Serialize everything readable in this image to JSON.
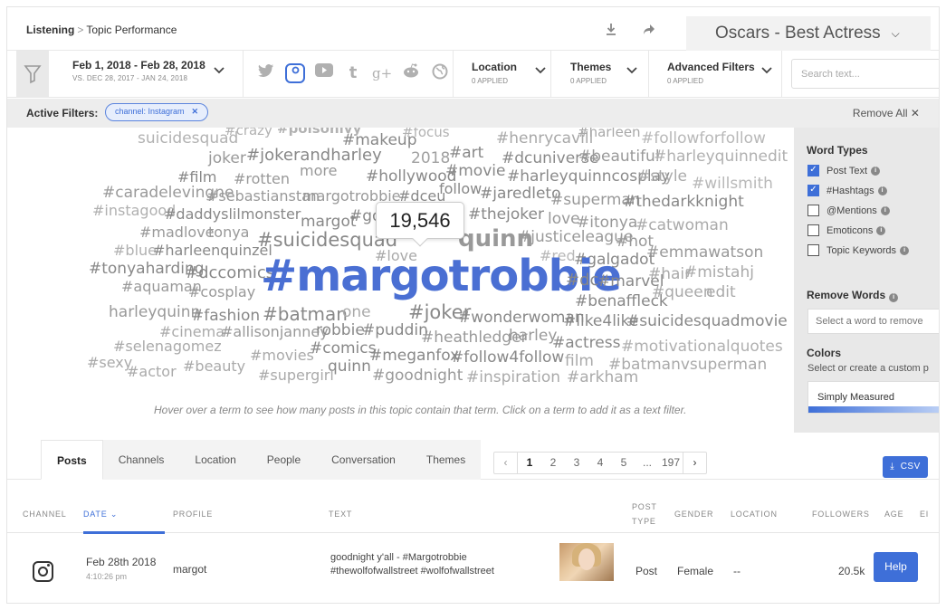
{
  "breadcrumb": {
    "root": "Listening",
    "separator": ">",
    "current": "Topic Performance"
  },
  "topic_selector": {
    "label": "Oscars - Best Actress"
  },
  "date_range": {
    "primary": "Feb 1, 2018 - Feb 28, 2018",
    "comparison": "VS. DEC 28, 2017 - JAN 24, 2018"
  },
  "networks": [
    "twitter-icon",
    "instagram-icon",
    "youtube-icon",
    "tumblr-icon",
    "google-plus-icon",
    "reddit-icon",
    "web-icon"
  ],
  "networks_glyphs": {
    "tumblr": "t",
    "google": "g+"
  },
  "filters": {
    "location": {
      "label": "Location",
      "sub": "0 APPLIED"
    },
    "themes": {
      "label": "Themes",
      "sub": "0 APPLIED"
    },
    "advanced": {
      "label": "Advanced Filters",
      "sub": "0 APPLIED"
    }
  },
  "search": {
    "placeholder": "Search text..."
  },
  "active_filters": {
    "label": "Active Filters:",
    "chip": "channel: Instagram",
    "chip_close": "✕",
    "remove_all": "Remove All ✕"
  },
  "word_cloud": {
    "tooltip": "19,546",
    "hint": "Hover over a term to see how many posts in this topic contain that term. Click on a term to add it as a text filter.",
    "words": [
      "suicidesquad",
      "#crazy",
      "#poisonivy",
      "#makeup",
      "#focus",
      "#henrycavill",
      "#harleen",
      "#followforfollow",
      "joker",
      "#jokerandharley",
      "2018",
      "#art",
      "#dcuniverse",
      "#beautiful",
      "#harleyquinnedit",
      "#film",
      "#rotten",
      "more",
      "#hollywood",
      "#movie",
      "#harleyquinncosplay",
      "#style",
      "#willsmith",
      "#caradelevingne",
      "#sebastianstan",
      "margotrobbie",
      "#dceu",
      "follow",
      "#jaredleto",
      "#superman",
      "#thedarkknight",
      "#instagood",
      "#daddyslilmonster",
      "margot",
      "#got",
      "#thejoker",
      "love",
      "#itonya",
      "#catwoman",
      "#madlove",
      "tonya",
      "#suicidesquad",
      "#love",
      "quinn",
      "#justiceleague",
      "#hot",
      "#blue",
      "#harleenquinzel",
      "#red",
      "#galgadot",
      "#emmawatson",
      "#tonyaharding",
      "#dccomics",
      "#margotrobbie",
      "#dc",
      "#marvel",
      "#hair",
      "#mistahj",
      "#aquaman",
      "#cosplay",
      "#benaffleck",
      "#queen",
      "edit",
      "harleyquinn",
      "#fashion",
      "#batman",
      "one",
      "#joker",
      "#wonderwoman",
      "#like4like",
      "#suicidesquadmovie",
      "#cinema",
      "#allisonjanney",
      "robbie",
      "#puddin",
      "#heathledger",
      "harley",
      "#actress",
      "#motivationalquotes",
      "#selenagomez",
      "#movies",
      "#comics",
      "#meganfox",
      "#follow4follow",
      "film",
      "#batmanvsuperman",
      "#sexy",
      "#actor",
      "#beauty",
      "quinn",
      "#supergirl",
      "#goodnight",
      "#inspiration",
      "#arkham"
    ]
  },
  "panel": {
    "word_types_title": "Word Types",
    "word_types": [
      {
        "label": "Post Text",
        "checked": true
      },
      {
        "label": "#Hashtags",
        "checked": true
      },
      {
        "label": "@Mentions",
        "checked": false
      },
      {
        "label": "Emoticons",
        "checked": false
      },
      {
        "label": "Topic Keywords",
        "checked": false
      }
    ],
    "remove_words_title": "Remove Words",
    "remove_words_placeholder": "Select a word to remove",
    "colors_title": "Colors",
    "colors_sub": "Select or create a custom p",
    "color_scheme": "Simply Measured"
  },
  "tabs": [
    "Posts",
    "Channels",
    "Location",
    "People",
    "Conversation",
    "Themes"
  ],
  "pager": {
    "pages": [
      "1",
      "2",
      "3",
      "4",
      "5",
      "...",
      "197"
    ],
    "current": "1"
  },
  "csv_button": "CSV",
  "table": {
    "headers": {
      "channel": "CHANNEL",
      "date": "DATE",
      "profile": "PROFILE",
      "text": "TEXT",
      "post_type_1": "POST",
      "post_type_2": "TYPE",
      "gender": "GENDER",
      "location": "LOCATION",
      "followers": "FOLLOWERS",
      "age": "AGE",
      "extra": "EI"
    },
    "row": {
      "date": "Feb 28th 2018",
      "time": "4:10:26 pm",
      "profile": "margot",
      "text_line1": "goodnight y'all - #Margotrobbie",
      "text_line2": "#thewolfofwallstreet #wolfofwallstreet",
      "post_type": "Post",
      "gender": "Female",
      "location": "--",
      "followers": "20.5k"
    }
  },
  "help_button": "Help",
  "colors": {
    "accent": "#3e6fd8",
    "word_gray": "#a3a3a3"
  }
}
